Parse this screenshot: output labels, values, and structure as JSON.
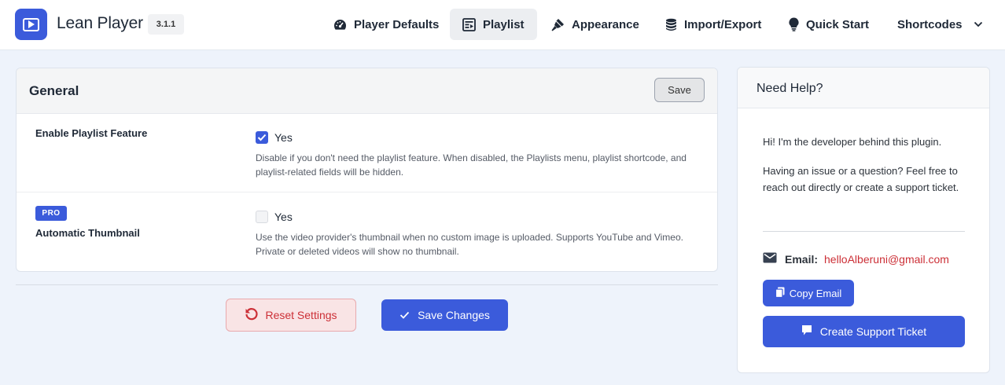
{
  "app": {
    "title": "Lean Player",
    "version": "3.1.1",
    "logo_icon": "play-icon",
    "brand_color": "#3b5bdb"
  },
  "nav": [
    {
      "label": "Player Defaults",
      "icon": "gauge-icon",
      "active": false
    },
    {
      "label": "Playlist",
      "icon": "playlist-icon",
      "active": true
    },
    {
      "label": "Appearance",
      "icon": "brush-icon",
      "active": false
    },
    {
      "label": "Import/Export",
      "icon": "database-icon",
      "active": false
    },
    {
      "label": "Quick Start",
      "icon": "lightbulb-icon",
      "active": false
    },
    {
      "label": "Shortcodes",
      "icon": "chevron-down-icon",
      "active": false
    }
  ],
  "general": {
    "title": "General",
    "save_label": "Save",
    "settings": [
      {
        "label": "Enable Playlist Feature",
        "checkbox_label": "Yes",
        "checked": true,
        "pro": false,
        "description": "Disable if you don't need the playlist feature. When disabled, the Playlists menu, playlist shortcode, and playlist-related fields will be hidden."
      },
      {
        "label": "Automatic Thumbnail",
        "badge": "PRO",
        "checkbox_label": "Yes",
        "checked": false,
        "pro": true,
        "description": "Use the video provider's thumbnail when no custom image is uploaded. Supports YouTube and Vimeo. Private or deleted videos will show no thumbnail."
      }
    ]
  },
  "actions": {
    "reset_label": "Reset Settings",
    "save_label": "Save Changes",
    "reset_color": "#cc2f36"
  },
  "help": {
    "title": "Need Help?",
    "intro": "Hi! I'm the developer behind this plugin.",
    "body": "Having an issue or a question? Feel free to reach out directly or create a support ticket.",
    "email_label": "Email:",
    "email": "helloAlberuni@gmail.com",
    "copy_label": "Copy Email",
    "ticket_label": "Create Support Ticket"
  }
}
